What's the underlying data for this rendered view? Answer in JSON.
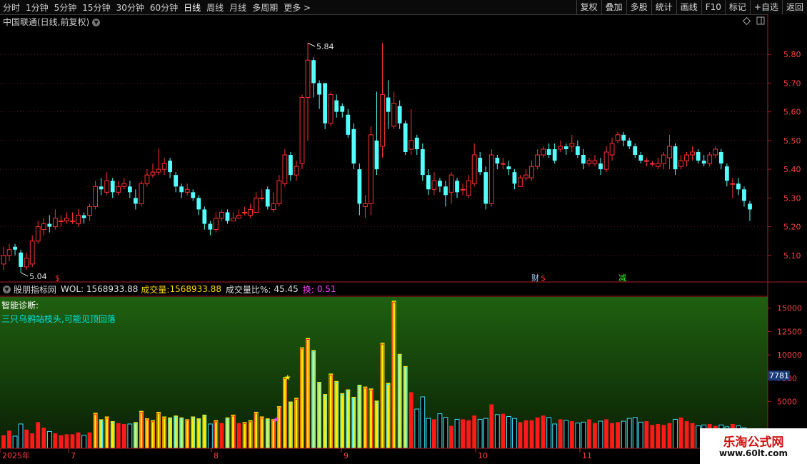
{
  "toolbar": {
    "periods": [
      "分时",
      "1分钟",
      "5分钟",
      "15分钟",
      "30分钟",
      "60分钟",
      "日线",
      "周线",
      "月线",
      "多周期",
      "更多 >"
    ],
    "active_period": "日线",
    "right": [
      "复权",
      "叠加",
      "多股",
      "统计",
      "画线",
      "F10",
      "标记",
      "+自选",
      "返回"
    ]
  },
  "stock_title": "中国联通(日线,前复权)",
  "chart_data": [
    {
      "type": "candlestick",
      "title": "中国联通(日线,前复权)",
      "y_ticks": [
        "5.80",
        "5.70",
        "5.60",
        "5.50",
        "5.40",
        "5.30",
        "5.20",
        "5.10"
      ],
      "ylim": [
        5.01,
        5.895
      ],
      "high_label": "5.84",
      "low_label": "5.04",
      "markers": {
        "dollar": "$",
        "cai": "财",
        "jian": "减"
      },
      "colors": {
        "up": "#ff3232",
        "down": "#54ffff"
      },
      "candles": [
        [
          5.07,
          5.1,
          5.05,
          5.13
        ],
        [
          5.1,
          5.12,
          5.08,
          5.14
        ],
        [
          5.13,
          5.12,
          5.1,
          5.14
        ],
        [
          5.11,
          5.06,
          5.04,
          5.12
        ],
        [
          5.06,
          5.09,
          5.05,
          5.11
        ],
        [
          5.07,
          5.15,
          5.06,
          5.17
        ],
        [
          5.15,
          5.2,
          5.14,
          5.22
        ],
        [
          5.19,
          5.21,
          5.17,
          5.23
        ],
        [
          5.21,
          5.2,
          5.18,
          5.24
        ],
        [
          5.2,
          5.23,
          5.19,
          5.26
        ],
        [
          5.22,
          5.22,
          5.2,
          5.24
        ],
        [
          5.22,
          5.23,
          5.21,
          5.25
        ],
        [
          5.22,
          5.22,
          5.21,
          5.25
        ],
        [
          5.21,
          5.24,
          5.2,
          5.26
        ],
        [
          5.24,
          5.23,
          5.21,
          5.25
        ],
        [
          5.24,
          5.27,
          5.22,
          5.28
        ],
        [
          5.27,
          5.34,
          5.26,
          5.36
        ],
        [
          5.34,
          5.33,
          5.31,
          5.37
        ],
        [
          5.32,
          5.36,
          5.31,
          5.39
        ],
        [
          5.36,
          5.32,
          5.3,
          5.37
        ],
        [
          5.32,
          5.34,
          5.31,
          5.36
        ],
        [
          5.34,
          5.35,
          5.33,
          5.37
        ],
        [
          5.34,
          5.32,
          5.3,
          5.36
        ],
        [
          5.3,
          5.28,
          5.26,
          5.33
        ],
        [
          5.28,
          5.35,
          5.27,
          5.36
        ],
        [
          5.35,
          5.38,
          5.34,
          5.4
        ],
        [
          5.38,
          5.39,
          5.37,
          5.42
        ],
        [
          5.39,
          5.4,
          5.38,
          5.47
        ],
        [
          5.4,
          5.42,
          5.38,
          5.44
        ],
        [
          5.43,
          5.39,
          5.37,
          5.44
        ],
        [
          5.38,
          5.34,
          5.32,
          5.39
        ],
        [
          5.34,
          5.32,
          5.3,
          5.35
        ],
        [
          5.32,
          5.33,
          5.31,
          5.35
        ],
        [
          5.32,
          5.3,
          5.29,
          5.33
        ],
        [
          5.3,
          5.26,
          5.24,
          5.31
        ],
        [
          5.26,
          5.21,
          5.19,
          5.27
        ],
        [
          5.21,
          5.19,
          5.17,
          5.22
        ],
        [
          5.19,
          5.23,
          5.18,
          5.25
        ],
        [
          5.23,
          5.25,
          5.22,
          5.26
        ],
        [
          5.25,
          5.22,
          5.21,
          5.26
        ],
        [
          5.22,
          5.23,
          5.22,
          5.25
        ],
        [
          5.23,
          5.24,
          5.23,
          5.26
        ],
        [
          5.25,
          5.25,
          5.24,
          5.27
        ],
        [
          5.24,
          5.26,
          5.23,
          5.28
        ],
        [
          5.25,
          5.3,
          5.25,
          5.32
        ],
        [
          5.3,
          5.3,
          5.29,
          5.33
        ],
        [
          5.33,
          5.27,
          5.26,
          5.34
        ],
        [
          5.26,
          5.28,
          5.25,
          5.32
        ],
        [
          5.28,
          5.36,
          5.27,
          5.38
        ],
        [
          5.35,
          5.45,
          5.34,
          5.47
        ],
        [
          5.45,
          5.38,
          5.36,
          5.46
        ],
        [
          5.38,
          5.41,
          5.36,
          5.43
        ],
        [
          5.42,
          5.65,
          5.4,
          5.66
        ],
        [
          5.65,
          5.78,
          5.5,
          5.84
        ],
        [
          5.78,
          5.7,
          5.65,
          5.79
        ],
        [
          5.7,
          5.66,
          5.61,
          5.71
        ],
        [
          5.7,
          5.56,
          5.54,
          5.7
        ],
        [
          5.56,
          5.66,
          5.55,
          5.67
        ],
        [
          5.64,
          5.6,
          5.58,
          5.66
        ],
        [
          5.62,
          5.6,
          5.58,
          5.63
        ],
        [
          5.59,
          5.52,
          5.51,
          5.61
        ],
        [
          5.54,
          5.42,
          5.4,
          5.56
        ],
        [
          5.4,
          5.28,
          5.24,
          5.42
        ],
        [
          5.27,
          5.28,
          5.23,
          5.31
        ],
        [
          5.28,
          5.52,
          5.24,
          5.55
        ],
        [
          5.5,
          5.4,
          5.38,
          5.67
        ],
        [
          5.48,
          5.66,
          5.44,
          5.84
        ],
        [
          5.65,
          5.6,
          5.54,
          5.71
        ],
        [
          5.55,
          5.63,
          5.54,
          5.67
        ],
        [
          5.62,
          5.56,
          5.54,
          5.64
        ],
        [
          5.56,
          5.46,
          5.45,
          5.57
        ],
        [
          5.47,
          5.5,
          5.45,
          5.61
        ],
        [
          5.51,
          5.47,
          5.45,
          5.52
        ],
        [
          5.47,
          5.38,
          5.36,
          5.49
        ],
        [
          5.38,
          5.33,
          5.31,
          5.4
        ],
        [
          5.33,
          5.36,
          5.31,
          5.39
        ],
        [
          5.36,
          5.34,
          5.32,
          5.37
        ],
        [
          5.34,
          5.31,
          5.27,
          5.36
        ],
        [
          5.32,
          5.38,
          5.28,
          5.39
        ],
        [
          5.36,
          5.32,
          5.3,
          5.37
        ],
        [
          5.33,
          5.33,
          5.31,
          5.35
        ],
        [
          5.31,
          5.36,
          5.3,
          5.38
        ],
        [
          5.35,
          5.45,
          5.34,
          5.49
        ],
        [
          5.44,
          5.39,
          5.38,
          5.46
        ],
        [
          5.39,
          5.28,
          5.26,
          5.41
        ],
        [
          5.28,
          5.45,
          5.27,
          5.47
        ],
        [
          5.44,
          5.42,
          5.4,
          5.45
        ],
        [
          5.42,
          5.42,
          5.4,
          5.44
        ],
        [
          5.41,
          5.4,
          5.38,
          5.43
        ],
        [
          5.39,
          5.35,
          5.33,
          5.4
        ],
        [
          5.34,
          5.37,
          5.34,
          5.38
        ],
        [
          5.37,
          5.38,
          5.36,
          5.4
        ],
        [
          5.37,
          5.41,
          5.36,
          5.43
        ],
        [
          5.41,
          5.45,
          5.4,
          5.47
        ],
        [
          5.45,
          5.47,
          5.44,
          5.48
        ],
        [
          5.47,
          5.45,
          5.44,
          5.49
        ],
        [
          5.47,
          5.43,
          5.42,
          5.49
        ],
        [
          5.47,
          5.48,
          5.46,
          5.5
        ],
        [
          5.48,
          5.47,
          5.45,
          5.49
        ],
        [
          5.48,
          5.49,
          5.46,
          5.52
        ],
        [
          5.48,
          5.45,
          5.44,
          5.5
        ],
        [
          5.45,
          5.42,
          5.4,
          5.47
        ],
        [
          5.42,
          5.43,
          5.41,
          5.44
        ],
        [
          5.42,
          5.43,
          5.41,
          5.45
        ],
        [
          5.42,
          5.4,
          5.38,
          5.44
        ],
        [
          5.4,
          5.46,
          5.39,
          5.48
        ],
        [
          5.45,
          5.49,
          5.43,
          5.51
        ],
        [
          5.5,
          5.52,
          5.49,
          5.53
        ],
        [
          5.52,
          5.5,
          5.48,
          5.53
        ],
        [
          5.5,
          5.48,
          5.47,
          5.51
        ],
        [
          5.48,
          5.45,
          5.44,
          5.49
        ],
        [
          5.45,
          5.43,
          5.42,
          5.46
        ],
        [
          5.43,
          5.43,
          5.41,
          5.44
        ],
        [
          5.42,
          5.42,
          5.41,
          5.43
        ],
        [
          5.41,
          5.42,
          5.4,
          5.44
        ],
        [
          5.42,
          5.45,
          5.4,
          5.46
        ],
        [
          5.44,
          5.48,
          5.4,
          5.52
        ],
        [
          5.48,
          5.4,
          5.38,
          5.49
        ],
        [
          5.41,
          5.43,
          5.4,
          5.45
        ],
        [
          5.43,
          5.45,
          5.41,
          5.46
        ],
        [
          5.45,
          5.46,
          5.43,
          5.48
        ],
        [
          5.46,
          5.43,
          5.42,
          5.47
        ],
        [
          5.43,
          5.42,
          5.41,
          5.45
        ],
        [
          5.42,
          5.45,
          5.41,
          5.46
        ],
        [
          5.45,
          5.47,
          5.44,
          5.48
        ],
        [
          5.46,
          5.42,
          5.4,
          5.47
        ],
        [
          5.41,
          5.36,
          5.34,
          5.42
        ],
        [
          5.35,
          5.35,
          5.3,
          5.37
        ],
        [
          5.35,
          5.33,
          5.31,
          5.37
        ],
        [
          5.33,
          5.29,
          5.27,
          5.34
        ],
        [
          5.28,
          5.26,
          5.22,
          5.29
        ]
      ]
    },
    {
      "type": "bar",
      "title": "VOL",
      "y_ticks": [
        "15000",
        "12500",
        "10000",
        "7500",
        "5000"
      ],
      "ylim": [
        0,
        16200
      ],
      "current_marker": "7781",
      "colors": {
        "up": "#ff2020",
        "down": "#40e6ff",
        "highlight": "#ffee00"
      },
      "x_labels": [
        "2025年",
        "7",
        "8",
        "9",
        "10",
        "11"
      ],
      "star_label": "★"
    }
  ],
  "indicator": {
    "name": "股朋指标网",
    "vol_label": "WOL: 1568933.88",
    "cjl_label": "成交量:",
    "cjl_value": "1568933.88",
    "ratio_label": "成交量比%:",
    "ratio_value": "45.45",
    "huan_label": "换:",
    "huan_value": "0.51"
  },
  "diagnosis": {
    "label": "智能诊断:",
    "text": "三只乌鸦站枝头,可能见顶回落"
  },
  "watermark": {
    "name": "乐淘公式网",
    "url": "www.60lt.com"
  }
}
